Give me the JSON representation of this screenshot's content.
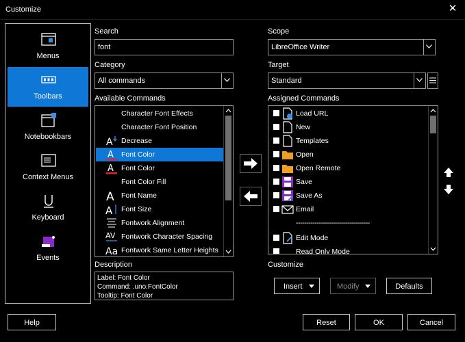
{
  "window": {
    "title": "Customize"
  },
  "sidebar": {
    "items": [
      {
        "label": "Menus",
        "icon": "menus-icon",
        "active": false
      },
      {
        "label": "Toolbars",
        "icon": "toolbars-icon",
        "active": true
      },
      {
        "label": "Notebookbars",
        "icon": "notebookbars-icon",
        "active": false
      },
      {
        "label": "Context Menus",
        "icon": "context-menus-icon",
        "active": false
      },
      {
        "label": "Keyboard",
        "icon": "keyboard-icon",
        "active": false
      },
      {
        "label": "Events",
        "icon": "events-icon",
        "active": false
      }
    ]
  },
  "search": {
    "label": "Search",
    "value": "font"
  },
  "category": {
    "label": "Category",
    "value": "All commands"
  },
  "available": {
    "label": "Available Commands",
    "items": [
      {
        "label": "Character Font Effects",
        "icon": ""
      },
      {
        "label": "Character Font Position",
        "icon": ""
      },
      {
        "label": "Decrease",
        "icon": "decrease-font-icon"
      },
      {
        "label": "Font Color",
        "icon": "font-color-icon",
        "selected": true
      },
      {
        "label": "Font Color",
        "icon": "font-color-icon"
      },
      {
        "label": "Font Color Fill",
        "icon": ""
      },
      {
        "label": "Font Name",
        "icon": "font-name-icon"
      },
      {
        "label": "Font Size",
        "icon": "font-size-icon"
      },
      {
        "label": "Fontwork Alignment",
        "icon": "fontwork-alignment-icon"
      },
      {
        "label": "Fontwork Character Spacing",
        "icon": "fontwork-spacing-icon"
      },
      {
        "label": "Fontwork Same Letter Heights",
        "icon": "fontwork-heights-icon"
      }
    ]
  },
  "description": {
    "label": "Description",
    "lines": [
      "Label: Font Color",
      "Command: .uno:FontColor",
      "Tooltip: Font Color"
    ]
  },
  "scope": {
    "label": "Scope",
    "value": "LibreOffice Writer"
  },
  "target": {
    "label": "Target",
    "value": "Standard"
  },
  "assigned": {
    "label": "Assigned Commands",
    "items": [
      {
        "label": "Load URL",
        "icon": "load-url-icon",
        "checked": true
      },
      {
        "label": "New",
        "icon": "new-document-icon",
        "checked": true
      },
      {
        "label": "Templates",
        "icon": "templates-icon",
        "checked": true
      },
      {
        "label": "Open",
        "icon": "folder-icon",
        "checked": true
      },
      {
        "label": "Open Remote",
        "icon": "folder-icon",
        "checked": true
      },
      {
        "label": "Save",
        "icon": "save-icon",
        "checked": true
      },
      {
        "label": "Save As",
        "icon": "save-as-icon",
        "checked": true
      },
      {
        "label": "Email",
        "icon": "email-icon",
        "checked": true
      },
      {
        "label": "------------------------------------",
        "separator": true
      },
      {
        "label": "Edit Mode",
        "icon": "edit-mode-icon",
        "checked": true
      },
      {
        "label": "Read Only Mode",
        "icon": "",
        "checked": true
      }
    ]
  },
  "customize": {
    "label": "Customize",
    "insert": "Insert",
    "modify": "Modify",
    "defaults": "Defaults"
  },
  "footer": {
    "help": "Help",
    "reset": "Reset",
    "ok": "OK",
    "cancel": "Cancel"
  },
  "colors": {
    "accent": "#0f78d6",
    "font_red": "#e0242c",
    "folder": "#f0a020",
    "save": "#8a2bc8"
  }
}
